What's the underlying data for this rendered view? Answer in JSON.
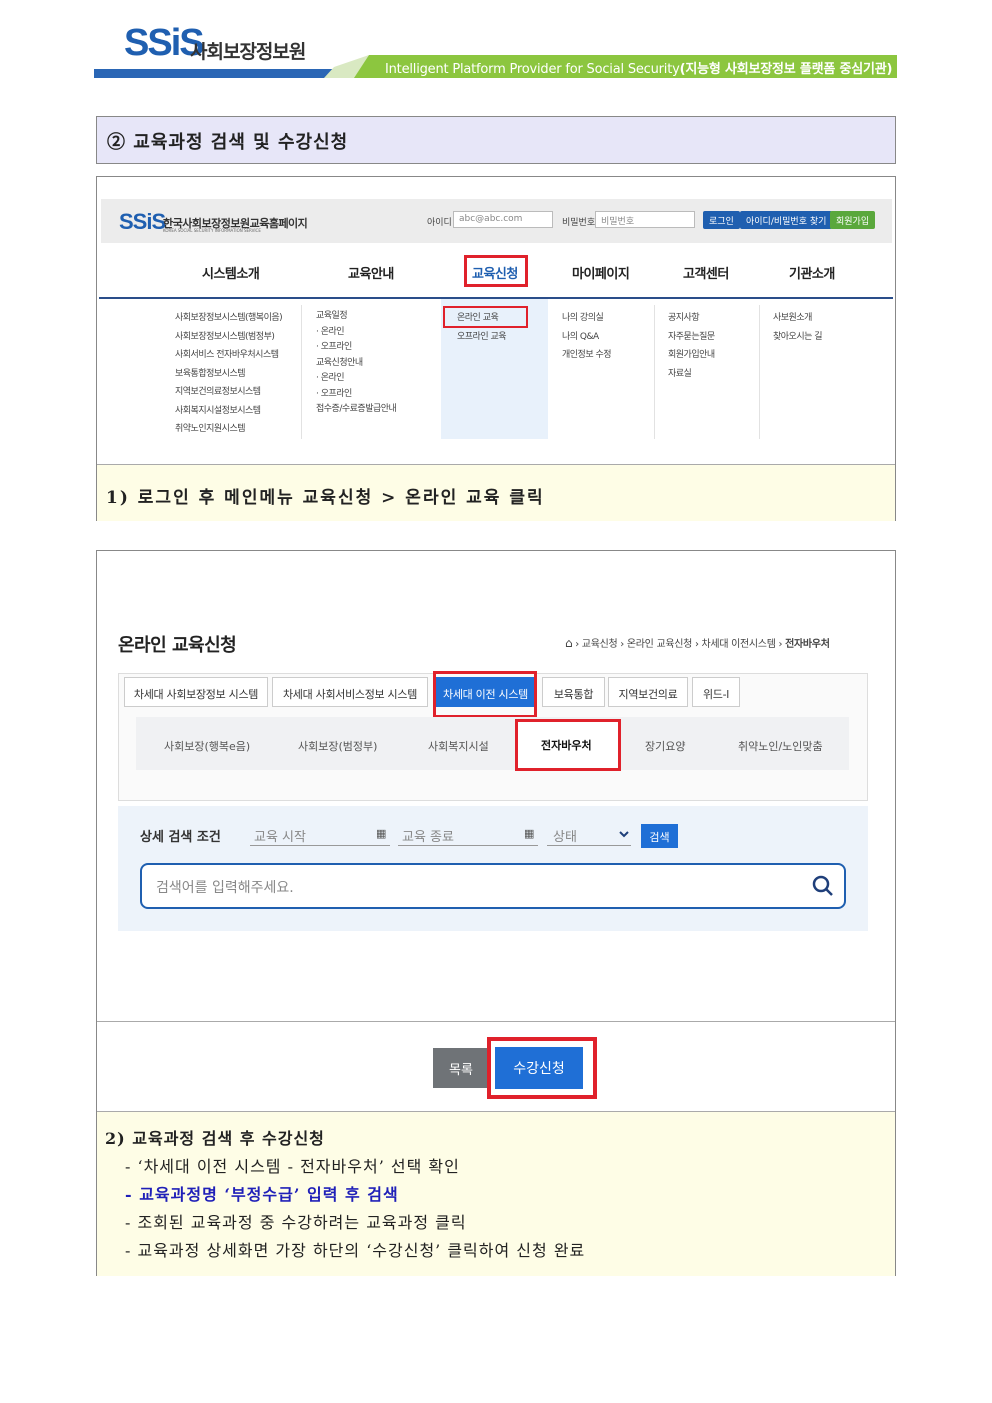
{
  "header": {
    "logo_mark": "SSiS",
    "org_name": "사회보장정보원",
    "tagline_en": "Intelligent Platform Provider for Social Security",
    "tagline_ko": "(지능형 사회보장정보 플랫폼 중심기관)",
    "bar_color": "#8cc63f"
  },
  "section_title": "② 교육과정 검색 및 수강신청",
  "panel1": {
    "site_name": "한국사회보장정보원교육홈페이지",
    "site_sub": "KOREA SOCIAL SECURITY INFORMATION SERVICE",
    "id_label": "아이디",
    "id_placeholder": "abc@abc.com",
    "pw_label": "비밀번호",
    "pw_placeholder": "비밀번호",
    "login_btn": "로그인",
    "find_btn": "아이디/비밀번호 찾기",
    "join_btn": "회원가입",
    "gnb": [
      "시스템소개",
      "교육안내",
      "교육신청",
      "마이페이지",
      "고객센터",
      "기관소개"
    ],
    "col1": [
      "사회보장정보시스템(행복이음)",
      "사회보장정보시스템(범정부)",
      "사회서비스 전자바우처시스템",
      "보육통합정보시스템",
      "지역보건의료정보시스템",
      "사회복지시설정보시스템",
      "취약노인지원시스템"
    ],
    "col2": [
      "교육일정",
      "· 온라인",
      "· 오프라인",
      "교육신청안내",
      "· 온라인",
      "· 오프라인",
      "접수증/수료증발급안내"
    ],
    "col3": [
      "온라인 교육",
      "오프라인 교육"
    ],
    "col4": [
      "나의 강의실",
      "나의 Q&A",
      "개인정보 수정"
    ],
    "col5": [
      "공지사항",
      "자주묻는질문",
      "회원가입안내",
      "자료실"
    ],
    "col6": [
      "사보원소개",
      "찾아오시는 길"
    ],
    "note": "1) 로그인 후 메인메뉴 교육신청 > 온라인 교육 클릭"
  },
  "panel2": {
    "page_title": "온라인 교육신청",
    "breadcrumb": [
      "교육신청",
      "온라인 교육신청",
      "차세대 이전시스템",
      "전자바우처"
    ],
    "tabs": [
      "차세대 사회보장정보 시스템",
      "차세대 사회서비스정보 시스템",
      "차세대 이전 시스템",
      "보육통합",
      "지역보건의료",
      "위드-l"
    ],
    "subtabs": [
      "사회보장(행복e음)",
      "사회보장(범정부)",
      "사회복지시설",
      "전자바우처",
      "장기요양",
      "취약노인/노인맞춤"
    ],
    "search_label": "상세 검색 조건",
    "start_placeholder": "교육 시작",
    "end_placeholder": "교육 종료",
    "status_placeholder": "상태",
    "search_btn": "검색",
    "keyword_placeholder": "검색어를 입력해주세요.",
    "list_btn": "목록",
    "apply_btn": "수강신청",
    "note_title": "2) 교육과정 검색 후 수강신청",
    "note_lines": [
      "- ‘차세대 이전 시스템 - 전자바우처’ 선택 확인",
      "- 교육과정명 ‘부정수급’ 입력 후 검색",
      "- 조회된 교육과정 중 수강하려는 교육과정 클릭",
      "- 교육과정 상세화면 가장 하단의 ‘수강신청’ 클릭하여 신청 완료"
    ],
    "highlight_color": "#1f1fb8"
  }
}
